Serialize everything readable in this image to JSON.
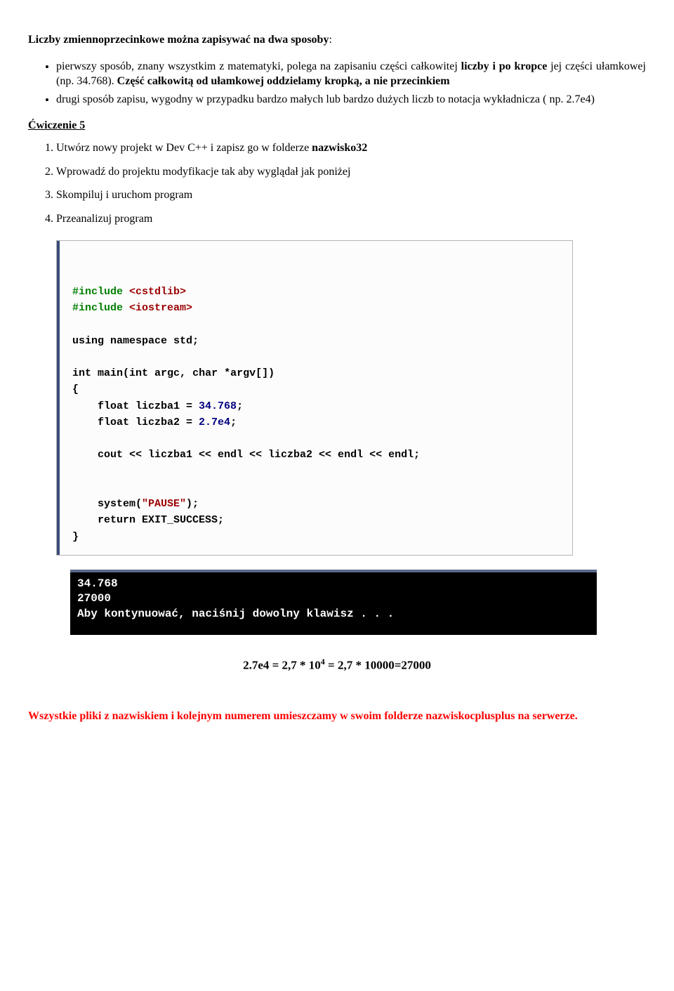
{
  "intro": {
    "lead_bold": "Liczby zmiennoprzecinkowe można zapisywać na dwa sposoby",
    "lead_suffix": ":",
    "bullet1_p1": "pierwszy sposób, znany wszystkim z matematyki, polega na zapisaniu części całkowitej ",
    "bullet1_b1": "liczby i po kropce",
    "bullet1_p2": " jej części ułamkowej (np. 34.768). ",
    "bullet1_b2": "Część całkowitą od ułamkowej oddzielamy kropką, a nie przecinkiem",
    "bullet2": "drugi sposób zapisu, wygodny w przypadku bardzo małych lub bardzo dużych liczb to notacja wykładnicza ( np. 2.7e4)"
  },
  "exercise": {
    "title": "Ćwiczenie 5",
    "step1_p1": "Utwórz nowy projekt w Dev C++ i zapisz go w folderze ",
    "step1_b": "nazwisko32",
    "step2": "Wprowadź do projektu modyfikacje tak aby wyglądał jak poniżej",
    "step3": "Skompiluj i uruchom program",
    "step4": "Przeanalizuj program"
  },
  "code": {
    "l01a": "#include ",
    "l01b": "<cstdlib>",
    "l02a": "#include ",
    "l02b": "<iostream>",
    "l03": "",
    "l04a": "using namespace",
    "l04b": " std;",
    "l05": "",
    "l06a": "int",
    "l06b": " main(",
    "l06c": "int",
    "l06d": " argc, ",
    "l06e": "char",
    "l06f": " *argv[])",
    "l07": "{",
    "l08a": "    float",
    "l08b": " liczba1 = ",
    "l08c": "34.768",
    "l08d": ";",
    "l09a": "    float",
    "l09b": " liczba2 = ",
    "l09c": "2.7e4",
    "l09d": ";",
    "l10": "",
    "l11": "    cout << liczba1 << endl << liczba2 << endl << endl;",
    "l12": "",
    "l13": "",
    "l14a": "    system(",
    "l14b": "\"PAUSE\"",
    "l14c": ");",
    "l15a": "    return",
    "l15b": " EXIT_SUCCESS;",
    "l16": "}"
  },
  "console": {
    "line1": "34.768",
    "line2": "27000",
    "line3": "Aby kontynuować, naciśnij dowolny klawisz . . ."
  },
  "equation": {
    "p1": "2.7e4 = 2,7 * 10",
    "sup": "4",
    "p2": " = 2,7 * 10000=27000"
  },
  "footer": {
    "p1": "Wszystkie pliki z nazwiskiem i kolejnym numerem umieszczamy w swoim folderze ",
    "p2": "nazwiskocplusplus na serwerze."
  }
}
